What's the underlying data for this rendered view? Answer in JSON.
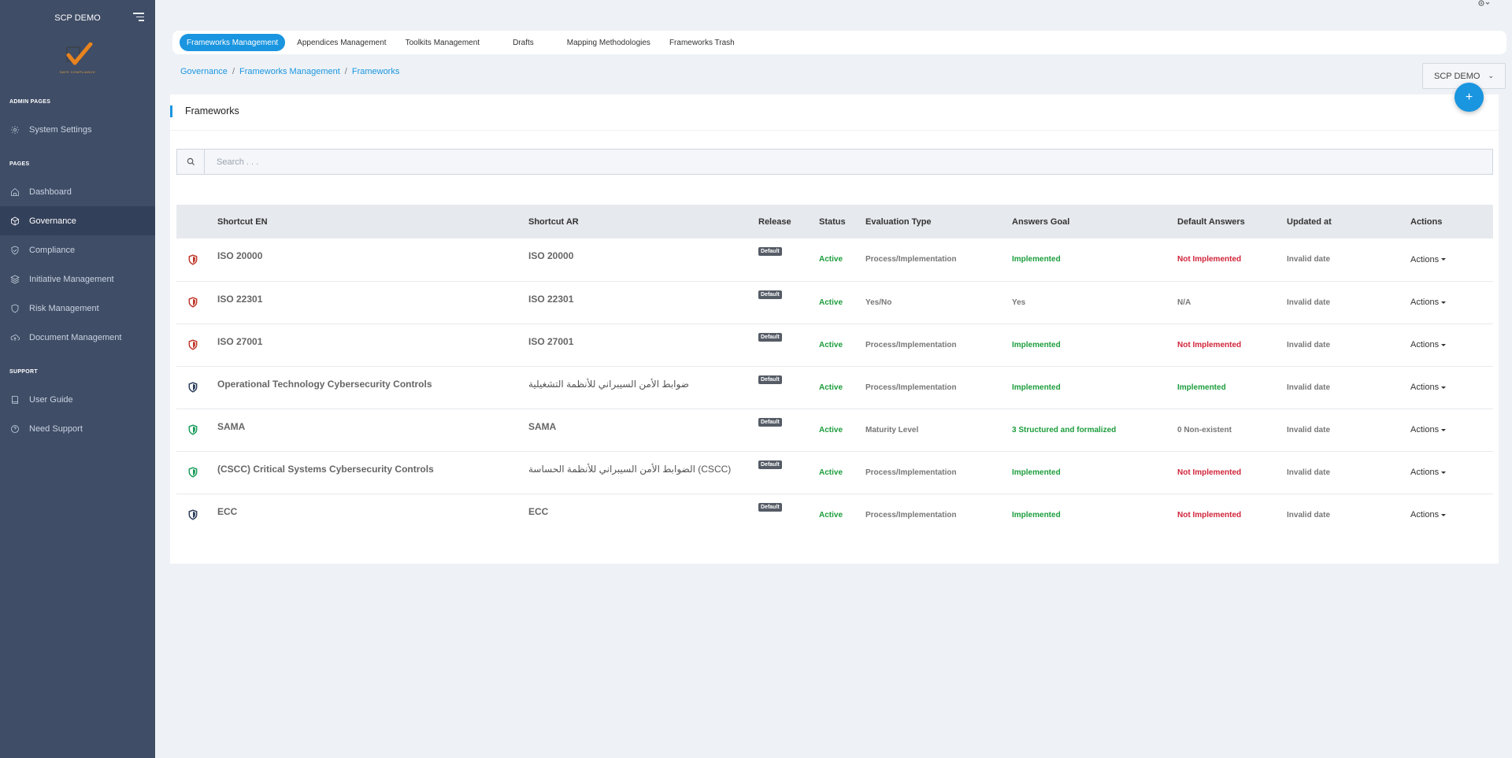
{
  "sidebar": {
    "app_title": "SCP DEMO",
    "logo_tagline": "SAFE COMPLIANCE",
    "sections": {
      "admin": "ADMIN PAGES",
      "pages": "PAGES",
      "support": "SUPPORT"
    },
    "items": {
      "system_settings": "System Settings",
      "dashboard": "Dashboard",
      "governance": "Governance",
      "compliance": "Compliance",
      "initiative": "Initiative Management",
      "risk": "Risk Management",
      "document": "Document Management",
      "user_guide": "User Guide",
      "need_support": "Need Support"
    }
  },
  "tabs": {
    "frameworks": "Frameworks Management",
    "appendices": "Appendices Management",
    "toolkits": "Toolkits Management",
    "drafts": "Drafts",
    "mapping": "Mapping Methodologies",
    "trash": "Frameworks Trash"
  },
  "breadcrumb": {
    "b1": "Governance",
    "b2": "Frameworks Management",
    "b3": "Frameworks",
    "sep": "/"
  },
  "org_select": {
    "value": "SCP DEMO"
  },
  "card": {
    "title": "Frameworks",
    "fab_label": "+"
  },
  "search": {
    "placeholder": "Search . . ."
  },
  "table": {
    "headers": {
      "shortcut_en": "Shortcut EN",
      "shortcut_ar": "Shortcut AR",
      "release": "Release",
      "status": "Status",
      "evaluation_type": "Evaluation Type",
      "answers_goal": "Answers Goal",
      "default_answers": "Default Answers",
      "updated_at": "Updated at",
      "actions": "Actions"
    },
    "rows": [
      {
        "shield_color": "#c0392b",
        "en": "ISO 20000",
        "ar": "ISO 20000",
        "release": "Default",
        "status": "Active",
        "eval": "Process/Implementation",
        "goal": "Implemented",
        "default": "Not Implemented",
        "updated": "Invalid date",
        "actions": "Actions"
      },
      {
        "shield_color": "#c0392b",
        "en": "ISO 22301",
        "ar": "ISO 22301",
        "release": "Default",
        "status": "Active",
        "eval": "Yes/No",
        "goal": "Yes",
        "default": "N/A",
        "updated": "Invalid date",
        "actions": "Actions"
      },
      {
        "shield_color": "#c0392b",
        "en": "ISO 27001",
        "ar": "ISO 27001",
        "release": "Default",
        "status": "Active",
        "eval": "Process/Implementation",
        "goal": "Implemented",
        "default": "Not Implemented",
        "updated": "Invalid date",
        "actions": "Actions"
      },
      {
        "shield_color": "#2c3e5a",
        "en": "Operational Technology Cybersecurity Controls",
        "ar": "ضوابط الأمن السيبراني للأنظمة التشغيلية",
        "release": "Default",
        "status": "Active",
        "eval": "Process/Implementation",
        "goal": "Implemented",
        "default": "Implemented",
        "updated": "Invalid date",
        "actions": "Actions"
      },
      {
        "shield_color": "#1c9d5c",
        "en": "SAMA",
        "ar": "SAMA",
        "release": "Default",
        "status": "Active",
        "eval": "Maturity Level",
        "goal": "3 Structured and formalized",
        "default": "0 Non-existent",
        "updated": "Invalid date",
        "actions": "Actions"
      },
      {
        "shield_color": "#1c9d5c",
        "en": "(CSCC) Critical Systems Cybersecurity Controls",
        "ar": "الضوابط الأمن السيبراني للأنظمة الحساسة (CSCC)",
        "release": "Default",
        "status": "Active",
        "eval": "Process/Implementation",
        "goal": "Implemented",
        "default": "Not Implemented",
        "updated": "Invalid date",
        "actions": "Actions"
      },
      {
        "shield_color": "#2c3e5a",
        "en": "ECC",
        "ar": "ECC",
        "release": "Default",
        "status": "Active",
        "eval": "Process/Implementation",
        "goal": "Implemented",
        "default": "Not Implemented",
        "updated": "Invalid date",
        "actions": "Actions"
      }
    ]
  },
  "colors": {
    "accent": "#1a95e0",
    "sidebar": "#3f4d66",
    "positive": "#1c9d3c",
    "negative": "#d0243a"
  }
}
